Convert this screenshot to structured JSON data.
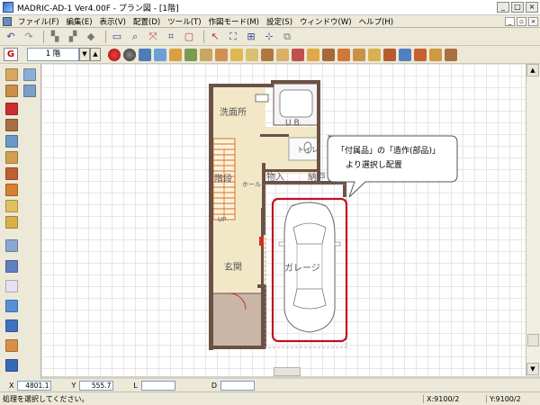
{
  "window": {
    "title": "MADRIC-AD-1 Ver4.00F - プラン図 - [1階]"
  },
  "menu": [
    {
      "label": "ファイル(F)"
    },
    {
      "label": "編集(E)"
    },
    {
      "label": "表示(V)"
    },
    {
      "label": "配置(D)"
    },
    {
      "label": "ツール(T)"
    },
    {
      "label": "作図モード(M)"
    },
    {
      "label": "設定(S)"
    },
    {
      "label": "ウィンドウ(W)"
    },
    {
      "label": "ヘルプ(H)"
    }
  ],
  "toolbar2": {
    "g_label": "G",
    "floor_value": "1 階"
  },
  "plan": {
    "rooms": {
      "senmenjo": "洗面所",
      "ub": "U B",
      "toilet": "トイレ",
      "kaidan": "階段",
      "hall": "ホール",
      "monoire": "物入",
      "nando": "納戸",
      "up": "UP",
      "genkan": "玄関",
      "garage": "ガレージ"
    },
    "callout_line1": "「付属品」の「造作(部品)」",
    "callout_line2": "より選択し配置"
  },
  "coords": {
    "x_label": "X",
    "x_value": "4801.1",
    "y_label": "Y",
    "y_value": "555.7",
    "l_label": "L",
    "d_label": "D"
  },
  "status": {
    "message": "処理を選択してください。",
    "cell1": "X:9100/2",
    "cell2": "Y:9100/2"
  },
  "colors": {
    "garage_highlight": "#c01020",
    "wall": "#6b5146",
    "floor_beige": "#f2e8c8",
    "stair": "#d87020"
  }
}
